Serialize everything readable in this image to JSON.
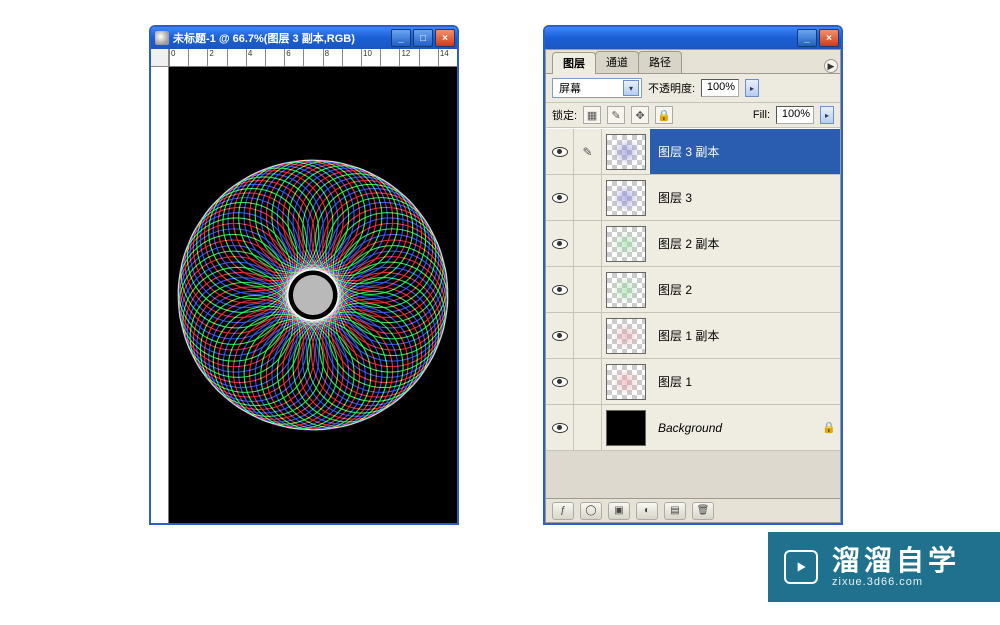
{
  "doc": {
    "title": "未标题-1 @ 66.7%(图层 3 副本,RGB)",
    "ruler_ticks": [
      "0",
      "",
      "2",
      "",
      "4",
      "",
      "6",
      "",
      "8",
      "",
      "10",
      "",
      "12",
      "",
      "14"
    ]
  },
  "win_btns": {
    "min": "_",
    "max": "□",
    "close": "×"
  },
  "panel": {
    "tabs": {
      "layers": "图层",
      "channels": "通道",
      "paths": "路径"
    },
    "blend_mode": "屏幕",
    "opacity_label": "不透明度:",
    "opacity_value": "100%",
    "lock_label": "锁定:",
    "fill_label": "Fill:",
    "fill_value": "100%"
  },
  "layers": [
    {
      "name": "图层 3 副本",
      "tint": "#7b7bd8",
      "selected": true,
      "bg": false
    },
    {
      "name": "图层 3",
      "tint": "#7b7bd8",
      "selected": false,
      "bg": false
    },
    {
      "name": "图层 2 副本",
      "tint": "#8fd89a",
      "selected": false,
      "bg": false
    },
    {
      "name": "图层 2",
      "tint": "#8fd89a",
      "selected": false,
      "bg": false
    },
    {
      "name": "图层 1 副本",
      "tint": "#e49aa0",
      "selected": false,
      "bg": false
    },
    {
      "name": "图层 1",
      "tint": "#e49aa0",
      "selected": false,
      "bg": false
    },
    {
      "name": "Background",
      "tint": "#000000",
      "selected": false,
      "bg": true
    }
  ],
  "footer_icons": [
    "fx",
    "mask",
    "set",
    "adj",
    "new",
    "trash"
  ],
  "badge": {
    "big": "溜溜自学",
    "small": "zixue.3d66.com"
  }
}
